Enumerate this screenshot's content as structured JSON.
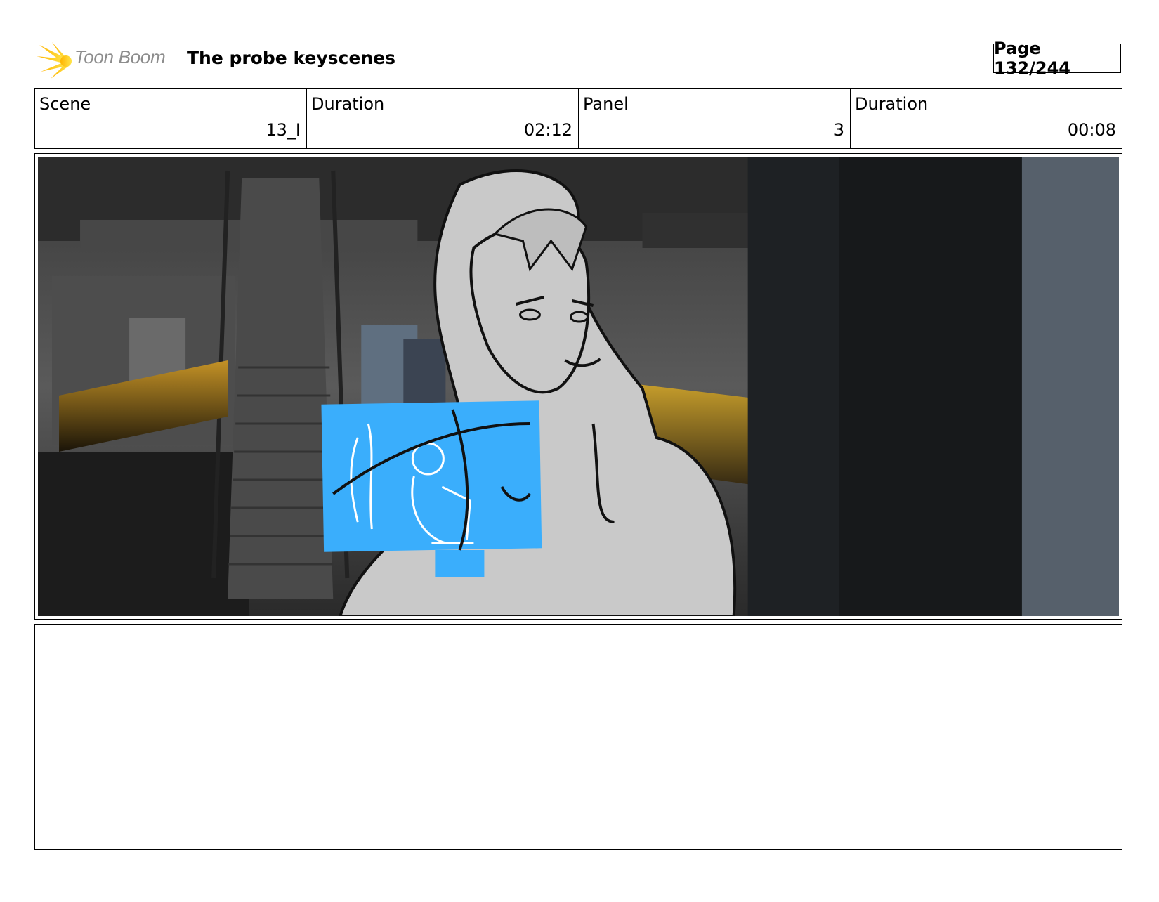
{
  "header": {
    "logo_text": "Toon Boom",
    "title": "The probe keyscenes",
    "page": "Page 132/244"
  },
  "info": {
    "scene_label": "Scene",
    "scene_value": "13_I",
    "scene_duration_label": "Duration",
    "scene_duration_value": "02:12",
    "panel_label": "Panel",
    "panel_value": "3",
    "panel_duration_label": "Duration",
    "panel_duration_value": "00:08"
  },
  "notes": {
    "text": ""
  },
  "colors": {
    "accent_logo": "#f5c400",
    "sketch_blue": "#3aaefc",
    "pipe_orange": "#b8861a"
  }
}
